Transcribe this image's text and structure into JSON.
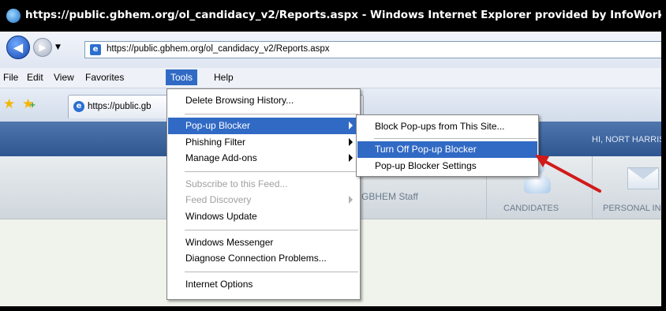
{
  "window": {
    "title": "https://public.gbhem.org/ol_candidacy_v2/Reports.aspx - Windows Internet Explorer provided by InfoWorks"
  },
  "address_bar": {
    "url": "https://public.gbhem.org/ol_candidacy_v2/Reports.aspx"
  },
  "menubar": {
    "items": [
      "File",
      "Edit",
      "View",
      "Favorites",
      "Tools",
      "Help"
    ]
  },
  "tabs": {
    "items": [
      {
        "label": "https://public.gb"
      }
    ]
  },
  "page": {
    "greeting": "HI, NORT HARRIS",
    "staff_label": "GBHEM Staff",
    "nav": [
      {
        "label": "CANDIDATES",
        "icon": "person-icon"
      },
      {
        "label": "PERSONAL IN",
        "icon": "envelope-icon"
      }
    ]
  },
  "tools_menu": {
    "items": [
      {
        "label": "Delete Browsing History..."
      },
      {
        "label": "Pop-up Blocker",
        "selected": true,
        "submenu": true
      },
      {
        "label": "Phishing Filter",
        "submenu": true
      },
      {
        "label": "Manage Add-ons",
        "submenu": true
      },
      {
        "label": "Subscribe to this Feed...",
        "disabled": true
      },
      {
        "label": "Feed Discovery",
        "disabled": true,
        "submenu": true
      },
      {
        "label": "Windows Update"
      },
      {
        "label": "Windows Messenger"
      },
      {
        "label": "Diagnose Connection Problems..."
      },
      {
        "label": "Internet Options"
      }
    ]
  },
  "popup_submenu": {
    "items": [
      {
        "label": "Block Pop-ups from This Site..."
      },
      {
        "label": "Turn Off Pop-up Blocker",
        "selected": true
      },
      {
        "label": "Pop-up Blocker Settings"
      }
    ]
  },
  "colors": {
    "selection": "#316ac5",
    "annotation_arrow": "#d11a1a",
    "header": "#3a5f98"
  }
}
